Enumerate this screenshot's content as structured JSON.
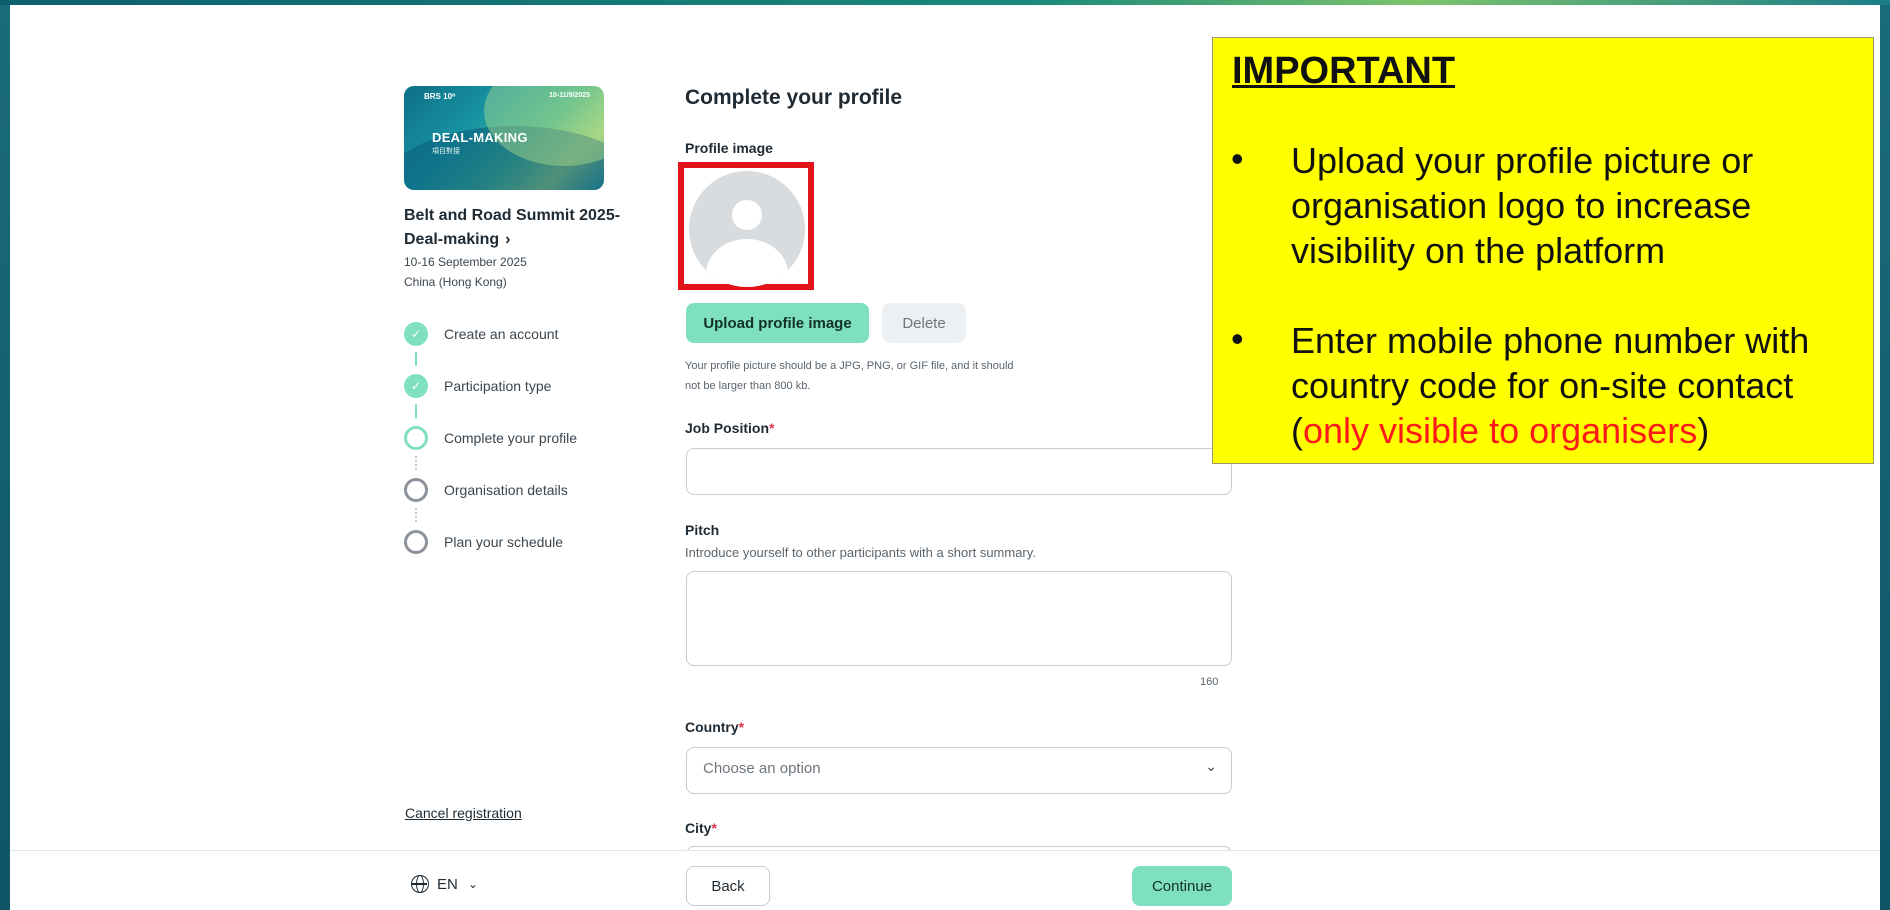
{
  "event": {
    "thumb_mark": "BRS 10⁰",
    "thumb_date": "10-11/9/2025",
    "thumb_title": "DEAL-MAKING",
    "thumb_subtitle": "項目對接",
    "title": "Belt and Road Summit 2025- Deal-making",
    "dates": "10-16 September 2025",
    "location": "China (Hong Kong)"
  },
  "steps": [
    {
      "label": "Create an account",
      "status": "done"
    },
    {
      "label": "Participation type",
      "status": "done"
    },
    {
      "label": "Complete your profile",
      "status": "current"
    },
    {
      "label": "Organisation details",
      "status": "todo"
    },
    {
      "label": "Plan your schedule",
      "status": "todo"
    }
  ],
  "cancel_label": "Cancel registration",
  "form": {
    "title": "Complete your profile",
    "profile_image_label": "Profile image",
    "upload_label": "Upload profile image",
    "delete_label": "Delete",
    "hint": "Your profile picture should be a JPG, PNG, or GIF file, and it should not be larger than 800 kb.",
    "job_position_label": "Job Position",
    "job_position_value": "",
    "pitch_label": "Pitch",
    "pitch_sublabel": "Introduce yourself to other participants with a short summary.",
    "pitch_value": "",
    "pitch_counter": "160",
    "country_label": "Country",
    "country_placeholder": "Choose an option",
    "city_label": "City",
    "required_mark": "*"
  },
  "footer": {
    "language": "EN",
    "back_label": "Back",
    "continue_label": "Continue"
  },
  "annotation": {
    "heading": "IMPORTANT",
    "bullet": "•",
    "item1": "Upload your profile picture or organisation logo to increase visibility on the platform",
    "item2_prefix": "Enter mobile phone number with country code for on-site contact (",
    "item2_red": "only visible to organisers",
    "item2_suffix": ")"
  },
  "colors": {
    "accent": "#7fe0bf",
    "highlight_border": "#e2131a",
    "note_background": "#ffff00",
    "note_red": "#ff1a1a"
  }
}
